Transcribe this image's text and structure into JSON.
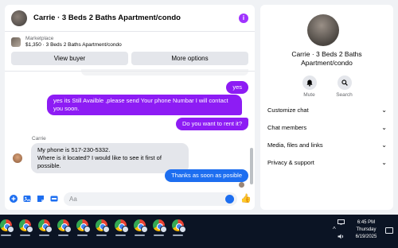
{
  "chat": {
    "header_title": "Carrie · 3 Beds 2 Baths Apartment/condo",
    "info_icon": "i",
    "listing": {
      "marketplace_label": "Marketplace",
      "price_line": "$1,350 · 3 Beds 2 Baths Apartment/condo",
      "view_buyer_label": "View buyer",
      "more_options_label": "More options"
    },
    "messages": [
      {
        "from": "me",
        "text": "yes"
      },
      {
        "from": "me",
        "text": "yes its Still Availble ,please send Your phone Numbar I will contact you soon."
      },
      {
        "from": "me",
        "text": "Do you want to rent it?"
      },
      {
        "from": "them",
        "sender": "Carrie",
        "text": "My phone is 517-230-5332.\nWhere is it located? I would like to see it first of possible."
      },
      {
        "from": "me",
        "text": "Thanks as soon as posible"
      }
    ],
    "composer_placeholder": "Aa",
    "like_icon": "thumbs-up-icon"
  },
  "details": {
    "title_line1": "Carrie · 3 Beds 2 Baths",
    "title_line2": "Apartment/condo",
    "mute_label": "Mute",
    "search_label": "Search",
    "sections": [
      {
        "label": "Customize chat"
      },
      {
        "label": "Chat members"
      },
      {
        "label": "Media, files and links"
      },
      {
        "label": "Privacy & support"
      }
    ]
  },
  "taskbar": {
    "time": "6:45 PM",
    "day": "Thursday",
    "date": "6/19/2025",
    "app_count": 10
  },
  "colors": {
    "accent_purple": "#8d1cf4",
    "accent_blue": "#1d6ef0"
  }
}
